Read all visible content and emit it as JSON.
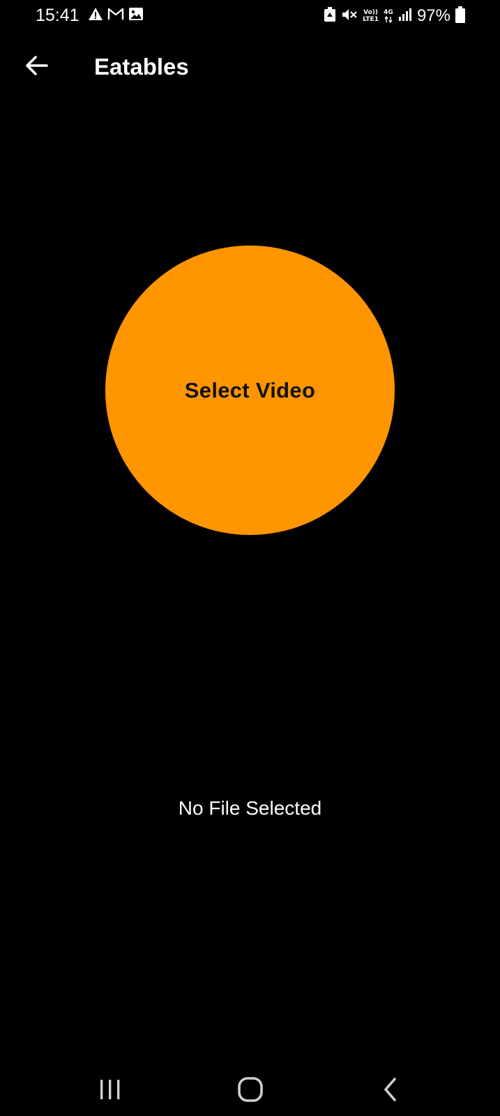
{
  "status_bar": {
    "time": "15:41",
    "left_icons": [
      "alert-icon",
      "gmail-icon",
      "gallery-icon"
    ],
    "network_top": "Vo))",
    "network_bottom": "LTE1",
    "network_type": "4G",
    "battery": "97%"
  },
  "app_bar": {
    "title": "Eatables"
  },
  "main": {
    "select_video_label": "Select Video",
    "file_status": "No File Selected"
  },
  "colors": {
    "background": "#000000",
    "accent": "#ff9500",
    "text": "#ffffff"
  },
  "nav_bar": {
    "buttons": [
      "recents-icon",
      "home-icon",
      "back-icon"
    ]
  }
}
